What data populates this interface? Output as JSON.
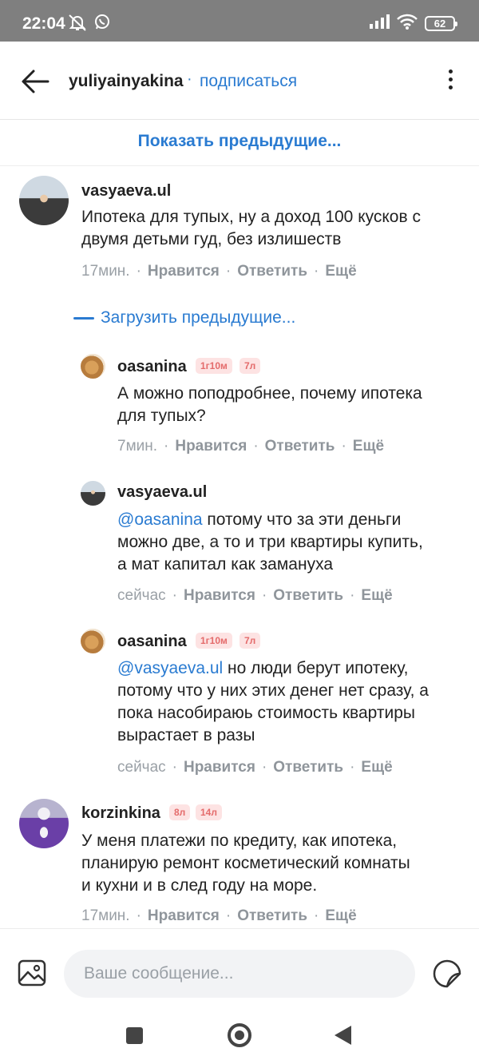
{
  "status_bar": {
    "time": "22:04",
    "battery": "62",
    "icons": [
      "mute-icon",
      "whatsapp-icon",
      "signal-icon",
      "wifi-icon",
      "battery-icon"
    ]
  },
  "header": {
    "username": "yuliyainyakina",
    "separator": "·",
    "follow_label": "подписаться"
  },
  "show_previous_label": "Показать предыдущие...",
  "load_previous_label": "Загрузить предыдущие...",
  "meta_actions": {
    "like": "Нравится",
    "reply": "Ответить",
    "more": "Ещё",
    "dot": "·"
  },
  "comments": [
    {
      "author": "vasyaeva.ul",
      "lines": [
        "Ипотека для тупых, ну а доход 100 кусков с",
        "двумя детьми гуд, без излишеств"
      ],
      "time": "17мин."
    },
    {
      "author": "oasanina",
      "badges": [
        "1г10м",
        "7л"
      ],
      "lines": [
        "А можно поподробнее, почему ипотека",
        "для тупых?"
      ],
      "time": "7мин."
    },
    {
      "author": "vasyaeva.ul",
      "mention": "@oasanina",
      "lines": [
        " потому что за эти деньги",
        "можно две, а то и три квартиры купить,",
        "а мат капитал как замануха"
      ],
      "time": "сейчас"
    },
    {
      "author": "oasanina",
      "badges": [
        "1г10м",
        "7л"
      ],
      "mention": "@vasyaeva.ul",
      "lines": [
        " но люди берут ипотеку,",
        "потому что у них этих денег нет сразу, а",
        "пока насобираюь стоимость квартиры",
        "вырастает в разы"
      ],
      "time": "сейчас"
    },
    {
      "author": "korzinkina",
      "badges": [
        "8л",
        "14л"
      ],
      "lines": [
        "У меня платежи по кредиту, как ипотека,",
        "планирую ремонт косметический комнаты",
        "и кухни и в след году на море."
      ],
      "time": "17мин."
    }
  ],
  "composer": {
    "placeholder": "Ваше сообщение..."
  },
  "colors": {
    "accent": "#2a7bd1",
    "badge_bg": "#fde3e3",
    "badge_text": "#e46b6b",
    "meta": "#9aa0a6",
    "status_bar": "#7f7f7f"
  }
}
